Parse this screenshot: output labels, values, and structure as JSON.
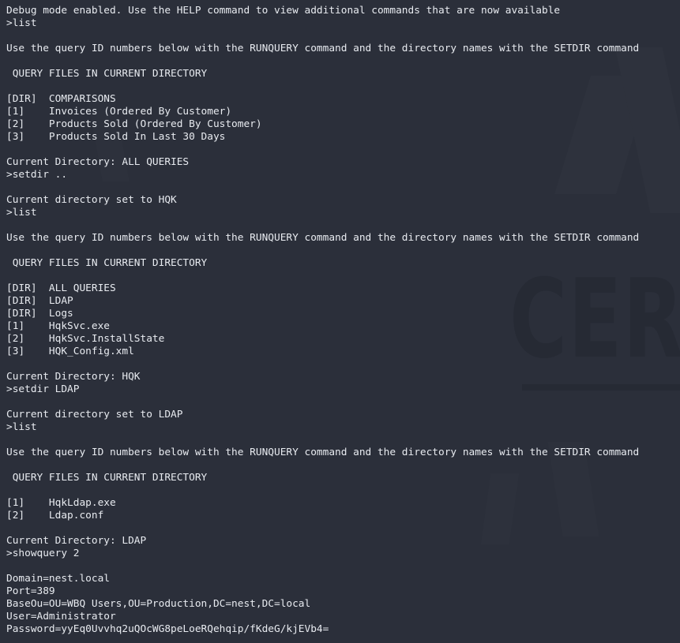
{
  "terminal": {
    "background_color": "#2b2f3a",
    "text_color": "#e8ebf0",
    "watermark_color": "#262a34",
    "watermark_text": "CER",
    "console_text": "Debug mode enabled. Use the HELP command to view additional commands that are now available\n>list\n\nUse the query ID numbers below with the RUNQUERY command and the directory names with the SETDIR command\n\n QUERY FILES IN CURRENT DIRECTORY\n\n[DIR]  COMPARISONS\n[1]    Invoices (Ordered By Customer)\n[2]    Products Sold (Ordered By Customer)\n[3]    Products Sold In Last 30 Days\n\nCurrent Directory: ALL QUERIES\n>setdir ..\n\nCurrent directory set to HQK\n>list\n\nUse the query ID numbers below with the RUNQUERY command and the directory names with the SETDIR command\n\n QUERY FILES IN CURRENT DIRECTORY\n\n[DIR]  ALL QUERIES\n[DIR]  LDAP\n[DIR]  Logs\n[1]    HqkSvc.exe\n[2]    HqkSvc.InstallState\n[3]    HQK_Config.xml\n\nCurrent Directory: HQK\n>setdir LDAP\n\nCurrent directory set to LDAP\n>list\n\nUse the query ID numbers below with the RUNQUERY command and the directory names with the SETDIR command\n\n QUERY FILES IN CURRENT DIRECTORY\n\n[1]    HqkLdap.exe\n[2]    Ldap.conf\n\nCurrent Directory: LDAP\n>showquery 2\n\nDomain=nest.local\nPort=389\nBaseOu=OU=WBQ Users,OU=Production,DC=nest,DC=local\nUser=Administrator\nPassword=yyEq0Uvvhq2uQOcWG8peLoeRQehqip/fKdeG/kjEVb4=",
    "sections": {
      "banner": "Debug mode enabled. Use the HELP command to view additional commands that are now available",
      "hint_line": "Use the query ID numbers below with the RUNQUERY command and the directory names with the SETDIR command",
      "listing_header": " QUERY FILES IN CURRENT DIRECTORY"
    },
    "commands": [
      ">list",
      ">setdir ..",
      ">list",
      ">setdir LDAP",
      ">list",
      ">showquery 2"
    ],
    "status_lines": [
      "Current Directory: ALL QUERIES",
      "Current directory set to HQK",
      "Current Directory: HQK",
      "Current directory set to LDAP",
      "Current Directory: LDAP"
    ],
    "listings": [
      {
        "directory": "ALL QUERIES",
        "entries": [
          {
            "id": "[DIR]",
            "name": "COMPARISONS"
          },
          {
            "id": "[1]",
            "name": "Invoices (Ordered By Customer)"
          },
          {
            "id": "[2]",
            "name": "Products Sold (Ordered By Customer)"
          },
          {
            "id": "[3]",
            "name": "Products Sold In Last 30 Days"
          }
        ]
      },
      {
        "directory": "HQK",
        "entries": [
          {
            "id": "[DIR]",
            "name": "ALL QUERIES"
          },
          {
            "id": "[DIR]",
            "name": "LDAP"
          },
          {
            "id": "[DIR]",
            "name": "Logs"
          },
          {
            "id": "[1]",
            "name": "HqkSvc.exe"
          },
          {
            "id": "[2]",
            "name": "HqkSvc.InstallState"
          },
          {
            "id": "[3]",
            "name": "HQK_Config.xml"
          }
        ]
      },
      {
        "directory": "LDAP",
        "entries": [
          {
            "id": "[1]",
            "name": "HqkLdap.exe"
          },
          {
            "id": "[2]",
            "name": "Ldap.conf"
          }
        ]
      }
    ],
    "query_result": {
      "Domain": "nest.local",
      "Port": "389",
      "BaseOu": "OU=WBQ Users,OU=Production,DC=nest,DC=local",
      "User": "Administrator",
      "Password": "yyEq0Uvvhq2uQOcWG8peLoeRQehqip/fKdeG/kjEVb4="
    }
  }
}
